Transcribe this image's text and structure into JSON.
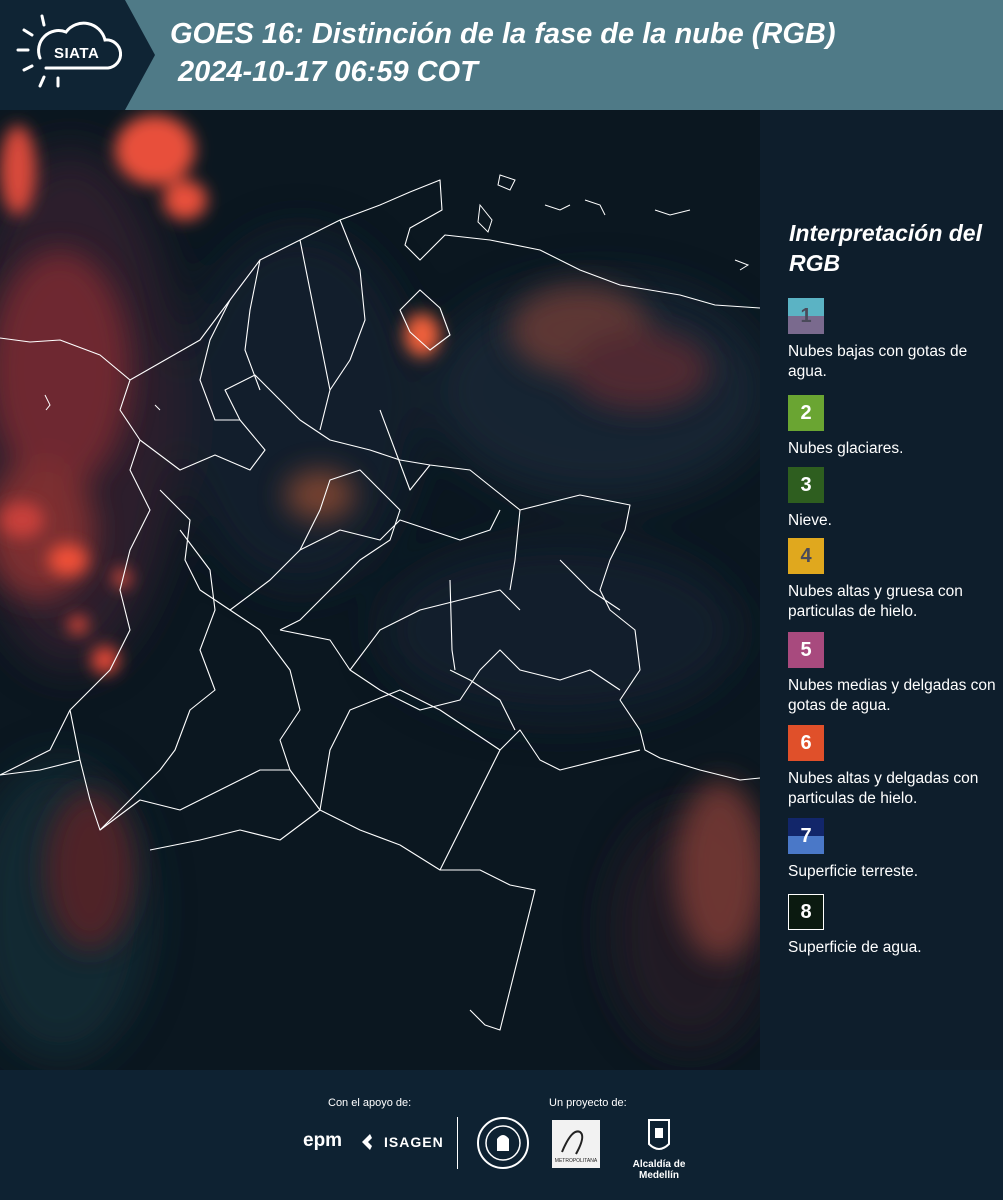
{
  "header": {
    "logo_text": "SIATA",
    "title": "GOES 16: Distinción de la fase de la nube (RGB)",
    "subtitle": "2024-10-17 06:59 COT"
  },
  "legend": {
    "title": "Interpretación del RGB",
    "items": [
      {
        "number": "1",
        "label": "Nubes bajas con gotas de agua.",
        "color_top": "#5bb3c4",
        "color_bottom": "#7a6a8e"
      },
      {
        "number": "2",
        "label": "Nubes glaciares.",
        "color": "#6aa532"
      },
      {
        "number": "3",
        "label": "Nieve.",
        "color": "#2e5e1f"
      },
      {
        "number": "4",
        "label": "Nubes altas y gruesa con particulas de hielo.",
        "color": "#e0a81e"
      },
      {
        "number": "5",
        "label": "Nubes medias y delgadas con gotas de agua.",
        "color": "#a84a7e"
      },
      {
        "number": "6",
        "label": "Nubes altas y delgadas con particulas de hielo.",
        "color": "#e0502a"
      },
      {
        "number": "7",
        "label": "Superficie terreste.",
        "color_top": "#12266a",
        "color_bottom": "#4a78c8"
      },
      {
        "number": "8",
        "label": "Superficie de agua.",
        "color": "#0b1a10"
      }
    ]
  },
  "footer": {
    "support_label": "Con el apoyo de:",
    "project_label": "Un proyecto de:",
    "epm": "epm",
    "isagen": "ISAGEN",
    "area_label": "METROPOLITANA",
    "alcaldia": "Alcaldía de Medellín"
  },
  "colors": {
    "header_bg": "#4f7a87",
    "footer_bg": "#0e2232",
    "map_bg": "#0a1620",
    "cloud_red": "#e0502a"
  },
  "icons": [
    "siata-sun-cloud-logo",
    "isagen-logo",
    "medellin-seal-icon",
    "area-metropolitana-logo",
    "alcaldia-shield-icon"
  ]
}
